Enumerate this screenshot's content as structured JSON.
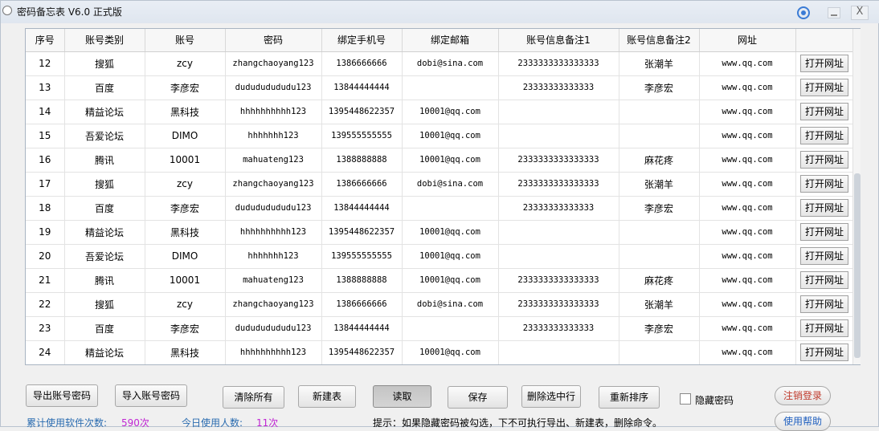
{
  "window": {
    "title": "密码备忘表 V6.0 正式版",
    "close_glyph": "X"
  },
  "table": {
    "columns": [
      "序号",
      "账号类别",
      "账号",
      "密码",
      "绑定手机号",
      "绑定邮箱",
      "账号信息备注1",
      "账号信息备注2",
      "网址",
      ""
    ],
    "rows": [
      [
        "12",
        "搜狐",
        "zcy",
        "zhangchaoyang123",
        "1386666666",
        "dobi@sina.com",
        "2333333333333333",
        "张潮羊",
        "www.qq.com",
        "打开网址"
      ],
      [
        "13",
        "百度",
        "李彦宏",
        "dudududududu123",
        "13844444444",
        "",
        "23333333333333",
        "李彦宏",
        "www.qq.com",
        "打开网址"
      ],
      [
        "14",
        "精益论坛",
        "黑科技",
        "hhhhhhhhhh123",
        "1395448622357",
        "10001@qq.com",
        "",
        "",
        "www.qq.com",
        "打开网址"
      ],
      [
        "15",
        "吾爱论坛",
        "DIMO",
        "hhhhhhh123",
        "139555555555",
        "10001@qq.com",
        "",
        "",
        "www.qq.com",
        "打开网址"
      ],
      [
        "16",
        "腾讯",
        "10001",
        "mahuateng123",
        "1388888888",
        "10001@qq.com",
        "2333333333333333",
        "麻花疼",
        "www.qq.com",
        "打开网址"
      ],
      [
        "17",
        "搜狐",
        "zcy",
        "zhangchaoyang123",
        "1386666666",
        "dobi@sina.com",
        "2333333333333333",
        "张潮羊",
        "www.qq.com",
        "打开网址"
      ],
      [
        "18",
        "百度",
        "李彦宏",
        "dudududududu123",
        "13844444444",
        "",
        "23333333333333",
        "李彦宏",
        "www.qq.com",
        "打开网址"
      ],
      [
        "19",
        "精益论坛",
        "黑科技",
        "hhhhhhhhhh123",
        "1395448622357",
        "10001@qq.com",
        "",
        "",
        "www.qq.com",
        "打开网址"
      ],
      [
        "20",
        "吾爱论坛",
        "DIMO",
        "hhhhhhh123",
        "139555555555",
        "10001@qq.com",
        "",
        "",
        "www.qq.com",
        "打开网址"
      ],
      [
        "21",
        "腾讯",
        "10001",
        "mahuateng123",
        "1388888888",
        "10001@qq.com",
        "2333333333333333",
        "麻花疼",
        "www.qq.com",
        "打开网址"
      ],
      [
        "22",
        "搜狐",
        "zcy",
        "zhangchaoyang123",
        "1386666666",
        "dobi@sina.com",
        "2333333333333333",
        "张潮羊",
        "www.qq.com",
        "打开网址"
      ],
      [
        "23",
        "百度",
        "李彦宏",
        "dudududududu123",
        "13844444444",
        "",
        "23333333333333",
        "李彦宏",
        "www.qq.com",
        "打开网址"
      ],
      [
        "24",
        "精益论坛",
        "黑科技",
        "hhhhhhhhhh123",
        "1395448622357",
        "10001@qq.com",
        "",
        "",
        "www.qq.com",
        "打开网址"
      ]
    ]
  },
  "toolbar": {
    "export_label": "导出账号密码",
    "import_label": "导入账号密码",
    "clear_label": "清除所有",
    "new_table_label": "新建表",
    "read_label": "读取",
    "save_label": "保存",
    "delete_label": "删除选中行",
    "reorder_label": "重新排序",
    "hide_password_label": "隐藏密码",
    "logout_label": "注销登录",
    "help_label": "使用帮助"
  },
  "status": {
    "total_uses_label": "累计使用软件次数:",
    "total_uses_value": "590次",
    "today_users_label": "今日使用人数:",
    "today_users_value": "11次",
    "hint": "提示：如果隐藏密码被勾选，下不可执行导出、新建表，删除命令。"
  },
  "colors": {
    "accent_blue": "#2b6cb0",
    "stat_value": "#c026d3",
    "logout_red": "#c0392b"
  }
}
